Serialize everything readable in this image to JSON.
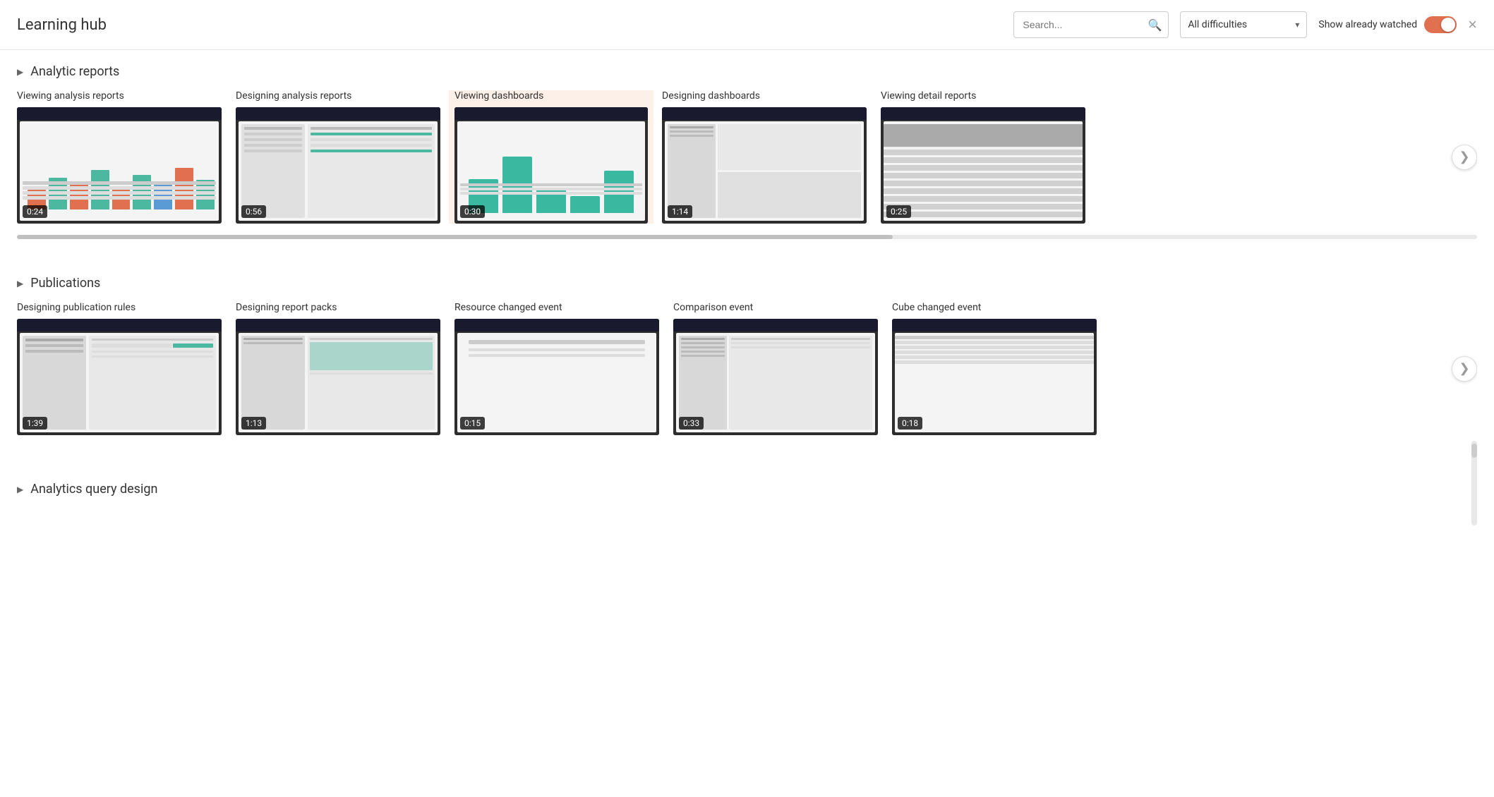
{
  "window": {
    "title": "Learning hub",
    "close_label": "×"
  },
  "header": {
    "search_placeholder": "Search...",
    "difficulty_label": "All difficulties",
    "watched_label": "Show already watched",
    "watched_enabled": true
  },
  "sections": [
    {
      "id": "analytic-reports",
      "title": "Analytic reports",
      "cards": [
        {
          "id": "viewing-analysis",
          "title": "Viewing analysis reports",
          "duration": "0:24",
          "highlighted": false
        },
        {
          "id": "designing-analysis",
          "title": "Designing analysis reports",
          "duration": "0:56",
          "highlighted": false
        },
        {
          "id": "viewing-dashboards",
          "title": "Viewing dashboards",
          "duration": "0:30",
          "highlighted": true
        },
        {
          "id": "designing-dashboards",
          "title": "Designing dashboards",
          "duration": "1:14",
          "highlighted": false
        },
        {
          "id": "viewing-detail",
          "title": "Viewing detail reports",
          "duration": "0:25",
          "highlighted": false
        }
      ]
    },
    {
      "id": "publications",
      "title": "Publications",
      "cards": [
        {
          "id": "publication-rules",
          "title": "Designing publication rules",
          "duration": "1:39",
          "highlighted": false
        },
        {
          "id": "report-packs",
          "title": "Designing report packs",
          "duration": "1:13",
          "highlighted": false
        },
        {
          "id": "resource-changed",
          "title": "Resource changed event",
          "duration": "0:15",
          "highlighted": false
        },
        {
          "id": "comparison-event",
          "title": "Comparison event",
          "duration": "0:33",
          "highlighted": false
        },
        {
          "id": "cube-changed",
          "title": "Cube changed event",
          "duration": "0:18",
          "highlighted": false
        }
      ]
    },
    {
      "id": "analytics-query",
      "title": "Analytics query design",
      "cards": []
    }
  ],
  "nav_arrow": "❯",
  "section_arrow_collapsed": "▶",
  "chevron": "▾"
}
